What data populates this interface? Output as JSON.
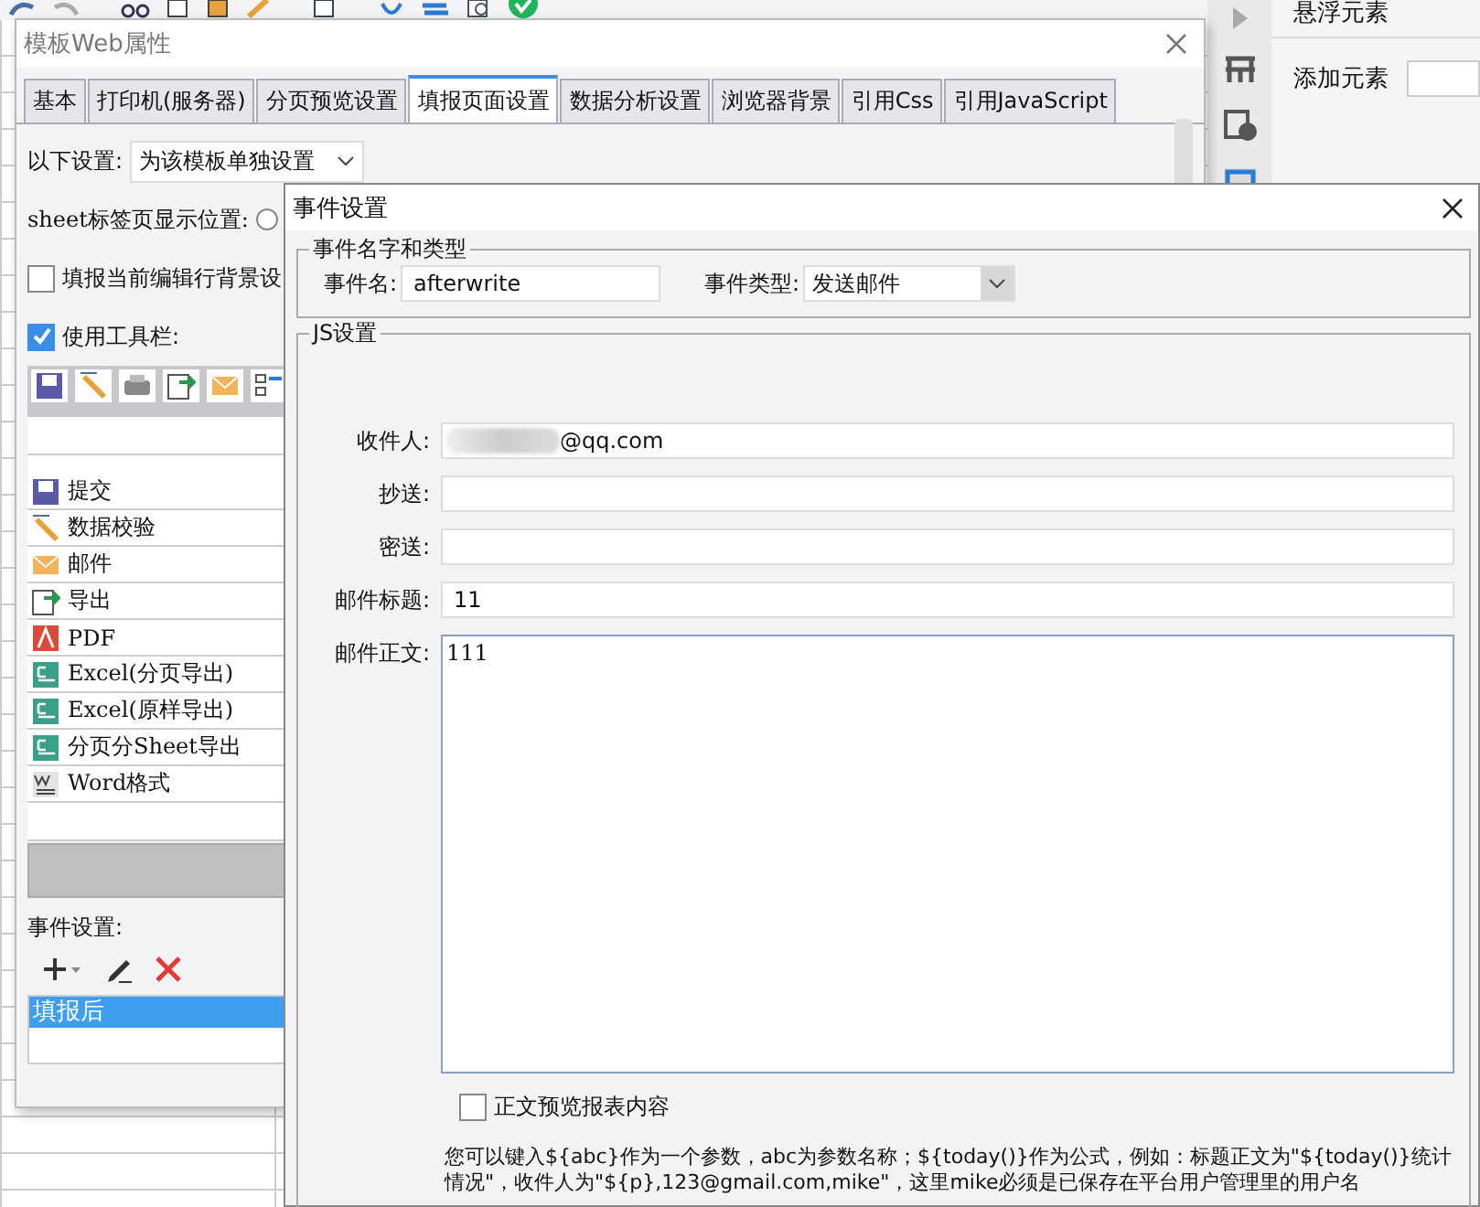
{
  "right_panel": {
    "title": "悬浮元素",
    "add_label": "添加元素"
  },
  "web_window": {
    "title": "模板Web属性",
    "tabs": [
      {
        "label": "基本",
        "selected": false
      },
      {
        "label": "打印机(服务器)",
        "selected": false
      },
      {
        "label": "分页预览设置",
        "selected": false
      },
      {
        "label": "填报页面设置",
        "selected": true
      },
      {
        "label": "数据分析设置",
        "selected": false
      },
      {
        "label": "浏览器背景",
        "selected": false
      },
      {
        "label": "引用Css",
        "selected": false
      },
      {
        "label": "引用JavaScript",
        "selected": false
      }
    ],
    "settings_label": "以下设置:",
    "settings_value": "为该模板单独设置",
    "sheet_position_label": "sheet标签页显示位置:",
    "sheet_position_radio": {
      "selected": false
    },
    "row_background": {
      "label": "填报当前编辑行背景设",
      "checked": false
    },
    "use_toolbar": {
      "label": "使用工具栏:",
      "checked": true
    },
    "toolbar_items": [
      {
        "kind": "submit",
        "label": "提交"
      },
      {
        "kind": "verify",
        "label": "数据校验"
      },
      {
        "kind": "mail",
        "label": "邮件"
      },
      {
        "kind": "export",
        "label": "导出"
      },
      {
        "kind": "pdf",
        "label": "PDF"
      },
      {
        "kind": "excel",
        "label": "Excel(分页导出)"
      },
      {
        "kind": "excel",
        "label": "Excel(原样导出)"
      },
      {
        "kind": "excel",
        "label": "分页分Sheet导出"
      },
      {
        "kind": "word",
        "label": "Word格式"
      }
    ],
    "event_label": "事件设置:",
    "events": [
      {
        "label": "填报后",
        "selected": true
      }
    ]
  },
  "event_dialog": {
    "title": "事件设置",
    "name_group": "事件名字和类型",
    "name_label": "事件名:",
    "name_value": "afterwrite",
    "type_label": "事件类型:",
    "type_value": "发送邮件",
    "js_group": "JS设置",
    "fields": [
      {
        "label": "收件人:",
        "value": "@qq.com",
        "masked": true
      },
      {
        "label": "抄送:",
        "masked": false
      },
      {
        "label": "密送:",
        "masked": false
      },
      {
        "label": "邮件标题:",
        "value": "11",
        "masked": false
      }
    ],
    "body": {
      "label": "邮件正文:",
      "value": "111"
    },
    "preview": {
      "label": "正文预览报表内容",
      "checked": false
    },
    "help": "您可以键入${abc}作为一个参数，abc为参数名称；${today()}作为公式，例如：标题正文为\"${today()}统计情况\"，收件人为\"${p},123@gmail.com,mike\"，这里mike必须是已保存在平台用户管理里的用户名"
  }
}
